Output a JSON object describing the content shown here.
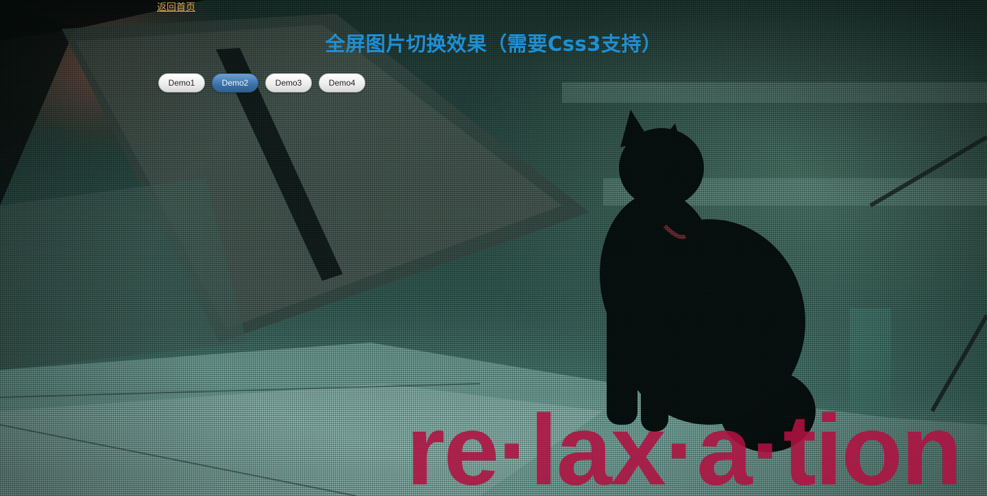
{
  "nav": {
    "home_link": "返回首页"
  },
  "header": {
    "title": "全屏图片切换效果（需要Css3支持）"
  },
  "demos": [
    {
      "label": "Demo1",
      "active": false
    },
    {
      "label": "Demo2",
      "active": true
    },
    {
      "label": "Demo3",
      "active": false
    },
    {
      "label": "Demo4",
      "active": false
    }
  ],
  "slide": {
    "caption": "re·lax·a·tion"
  },
  "colors": {
    "home_link": "#e0a64a",
    "title": "#1e8fd6",
    "active_button": "#3e74aa",
    "caption": "#b01242"
  }
}
